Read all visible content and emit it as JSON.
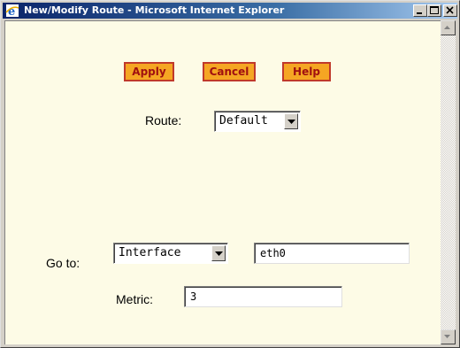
{
  "window": {
    "title": "New/Modify Route - Microsoft Internet Explorer"
  },
  "toolbar": {
    "apply_label": "Apply",
    "cancel_label": "Cancel",
    "help_label": "Help"
  },
  "form": {
    "route_label": "Route:",
    "route_value": "Default",
    "goto_label": "Go to:",
    "goto_value": "Interface",
    "interface_value": "eth0",
    "metric_label": "Metric:",
    "metric_value": "3"
  },
  "colors": {
    "button_fill": "#f5a623",
    "button_border": "#c0392b",
    "button_text": "#a01010",
    "page_background": "#fdfbe6",
    "titlebar": "#0a246a"
  },
  "icons": {
    "title": "ie-logo-icon",
    "minimize": "minimize-icon",
    "maximize": "maximize-icon",
    "close": "close-icon",
    "select_arrow": "chevron-down-icon"
  }
}
